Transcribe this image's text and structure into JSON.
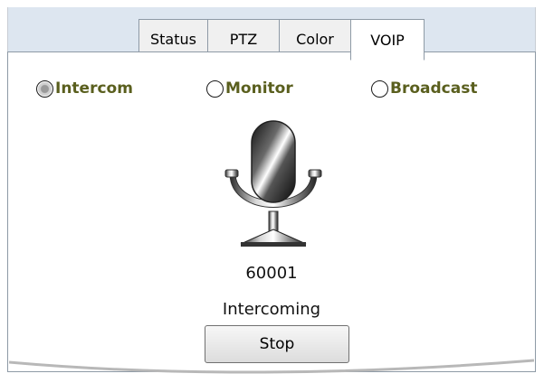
{
  "tabs": [
    "Status",
    "PTZ",
    "Color",
    "VOIP"
  ],
  "active_tab": "VOIP",
  "modes": {
    "intercom": {
      "label": "Intercom",
      "checked": true
    },
    "monitor": {
      "label": "Monitor",
      "checked": false
    },
    "broadcast": {
      "label": "Broadcast",
      "checked": false
    }
  },
  "port": "60001",
  "status": "Intercoming",
  "stop_label": "Stop",
  "icons": {
    "mic": "microphone-icon"
  }
}
